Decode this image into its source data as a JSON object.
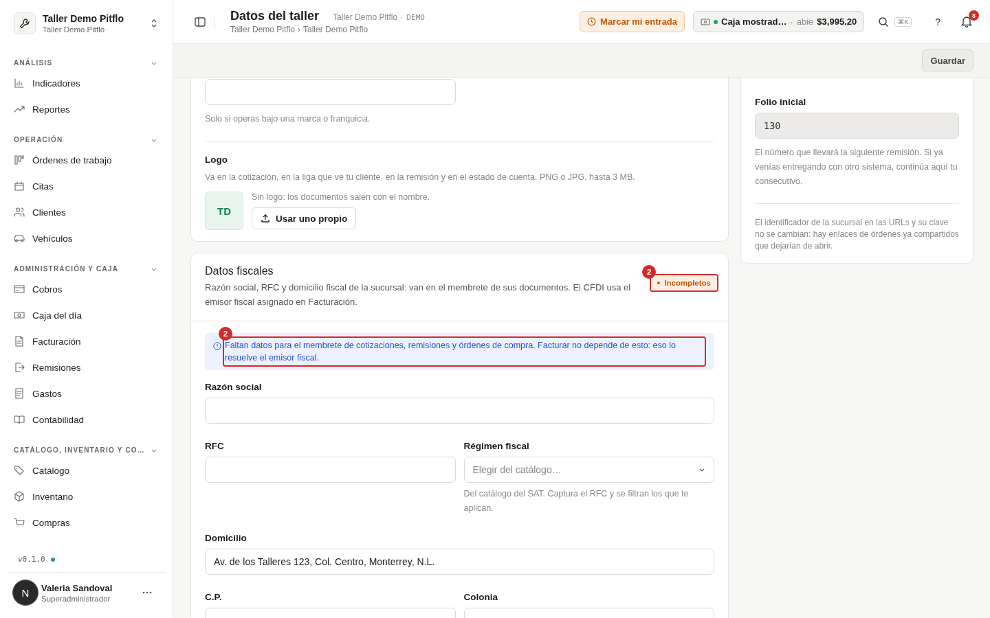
{
  "sidebar": {
    "workspace": {
      "name": "Taller Demo Pitflo",
      "subtitle": "Taller Demo Pitflo"
    },
    "sections": [
      {
        "title": "ANÁLISIS",
        "expanded": true,
        "items": [
          {
            "label": "Indicadores"
          },
          {
            "label": "Reportes"
          }
        ]
      },
      {
        "title": "OPERACIÓN",
        "expanded": true,
        "items": [
          {
            "label": "Órdenes de trabajo"
          },
          {
            "label": "Citas"
          },
          {
            "label": "Clientes"
          },
          {
            "label": "Vehículos"
          }
        ]
      },
      {
        "title": "ADMINISTRACIÓN Y CAJA",
        "expanded": true,
        "items": [
          {
            "label": "Cobros"
          },
          {
            "label": "Caja del día"
          },
          {
            "label": "Facturación"
          },
          {
            "label": "Remisiones"
          },
          {
            "label": "Gastos"
          },
          {
            "label": "Contabilidad"
          }
        ]
      },
      {
        "title": "CATÁLOGO, INVENTARIO Y CO…",
        "expanded": true,
        "items": [
          {
            "label": "Catálogo"
          },
          {
            "label": "Inventario"
          },
          {
            "label": "Compras"
          }
        ]
      }
    ],
    "version": "v0.1.0",
    "user": {
      "initial": "N",
      "name": "Valeria Sandoval",
      "role": "Superadministrador"
    }
  },
  "header": {
    "title": "Datos del taller",
    "context": "Taller Demo Pitflo ·",
    "environment": "DEMO",
    "breadcrumb": [
      "Taller Demo Pitflo",
      "Taller Demo Pitflo"
    ],
    "breadcrumb_separator": "›",
    "clock_in": "Marcar mi entrada",
    "cash": {
      "name": "Caja mostrad…",
      "separator": "·",
      "status": "abie",
      "amount": "$3,995.20"
    },
    "shortcut": "⌘K",
    "help": "?",
    "notifications": "8"
  },
  "save_button": "Guardar",
  "brand_card": {
    "field": {
      "hint": "Solo si operas bajo una marca o franquicia."
    },
    "logo": {
      "label": "Logo",
      "description": "Va en la cotización, en la liga que ve tu cliente, en la remisión y en el estado de cuenta. PNG o JPG, hasta 3 MB.",
      "initials": "TD",
      "note": "Sin logo: los documentos salen con el nombre.",
      "button": "Usar uno propio"
    }
  },
  "fiscal_card": {
    "title": "Datos fiscales",
    "description": "Razón social, RFC y domicilio fiscal de la sucursal: van en el membrete de sus documentos. El CFDI usa el emisor fiscal asignado en Facturación.",
    "status": {
      "label": "Incompletos",
      "marker": "2"
    },
    "alert": {
      "text": "Faltan datos para el membrete de cotizaciones, remisiones y órdenes de compra. Facturar no depende de esto: eso lo resuelve el emisor fiscal.",
      "marker": "2"
    },
    "rows": [
      [
        {
          "label": "Razón social",
          "kind": "text"
        }
      ],
      [
        {
          "label": "RFC",
          "kind": "text"
        },
        {
          "label": "Régimen fiscal",
          "kind": "select",
          "placeholder": "Elegir del catálogo…",
          "hint": "Del catálogo del SAT. Captura el RFC y se filtran los que te aplican."
        }
      ],
      [
        {
          "label": "Domicilio",
          "kind": "text",
          "value": "Av. de los Talleres 123, Col. Centro, Monterrey, N.L."
        }
      ],
      [
        {
          "label": "C.P.",
          "kind": "text"
        },
        {
          "label": "Colonia",
          "kind": "text"
        }
      ]
    ]
  },
  "folio_card": {
    "label": "Folio inicial",
    "value": "130",
    "disabled": true,
    "hint": "El número que llevará la siguiente remisión. Si ya venías entregando con otro sistema, continúa aquí tu consecutivo.",
    "note": "El identificador de la sucursal en las URLs y su clave no se cambian: hay enlaces de órdenes ya compartidos que dejarían de abrir."
  }
}
